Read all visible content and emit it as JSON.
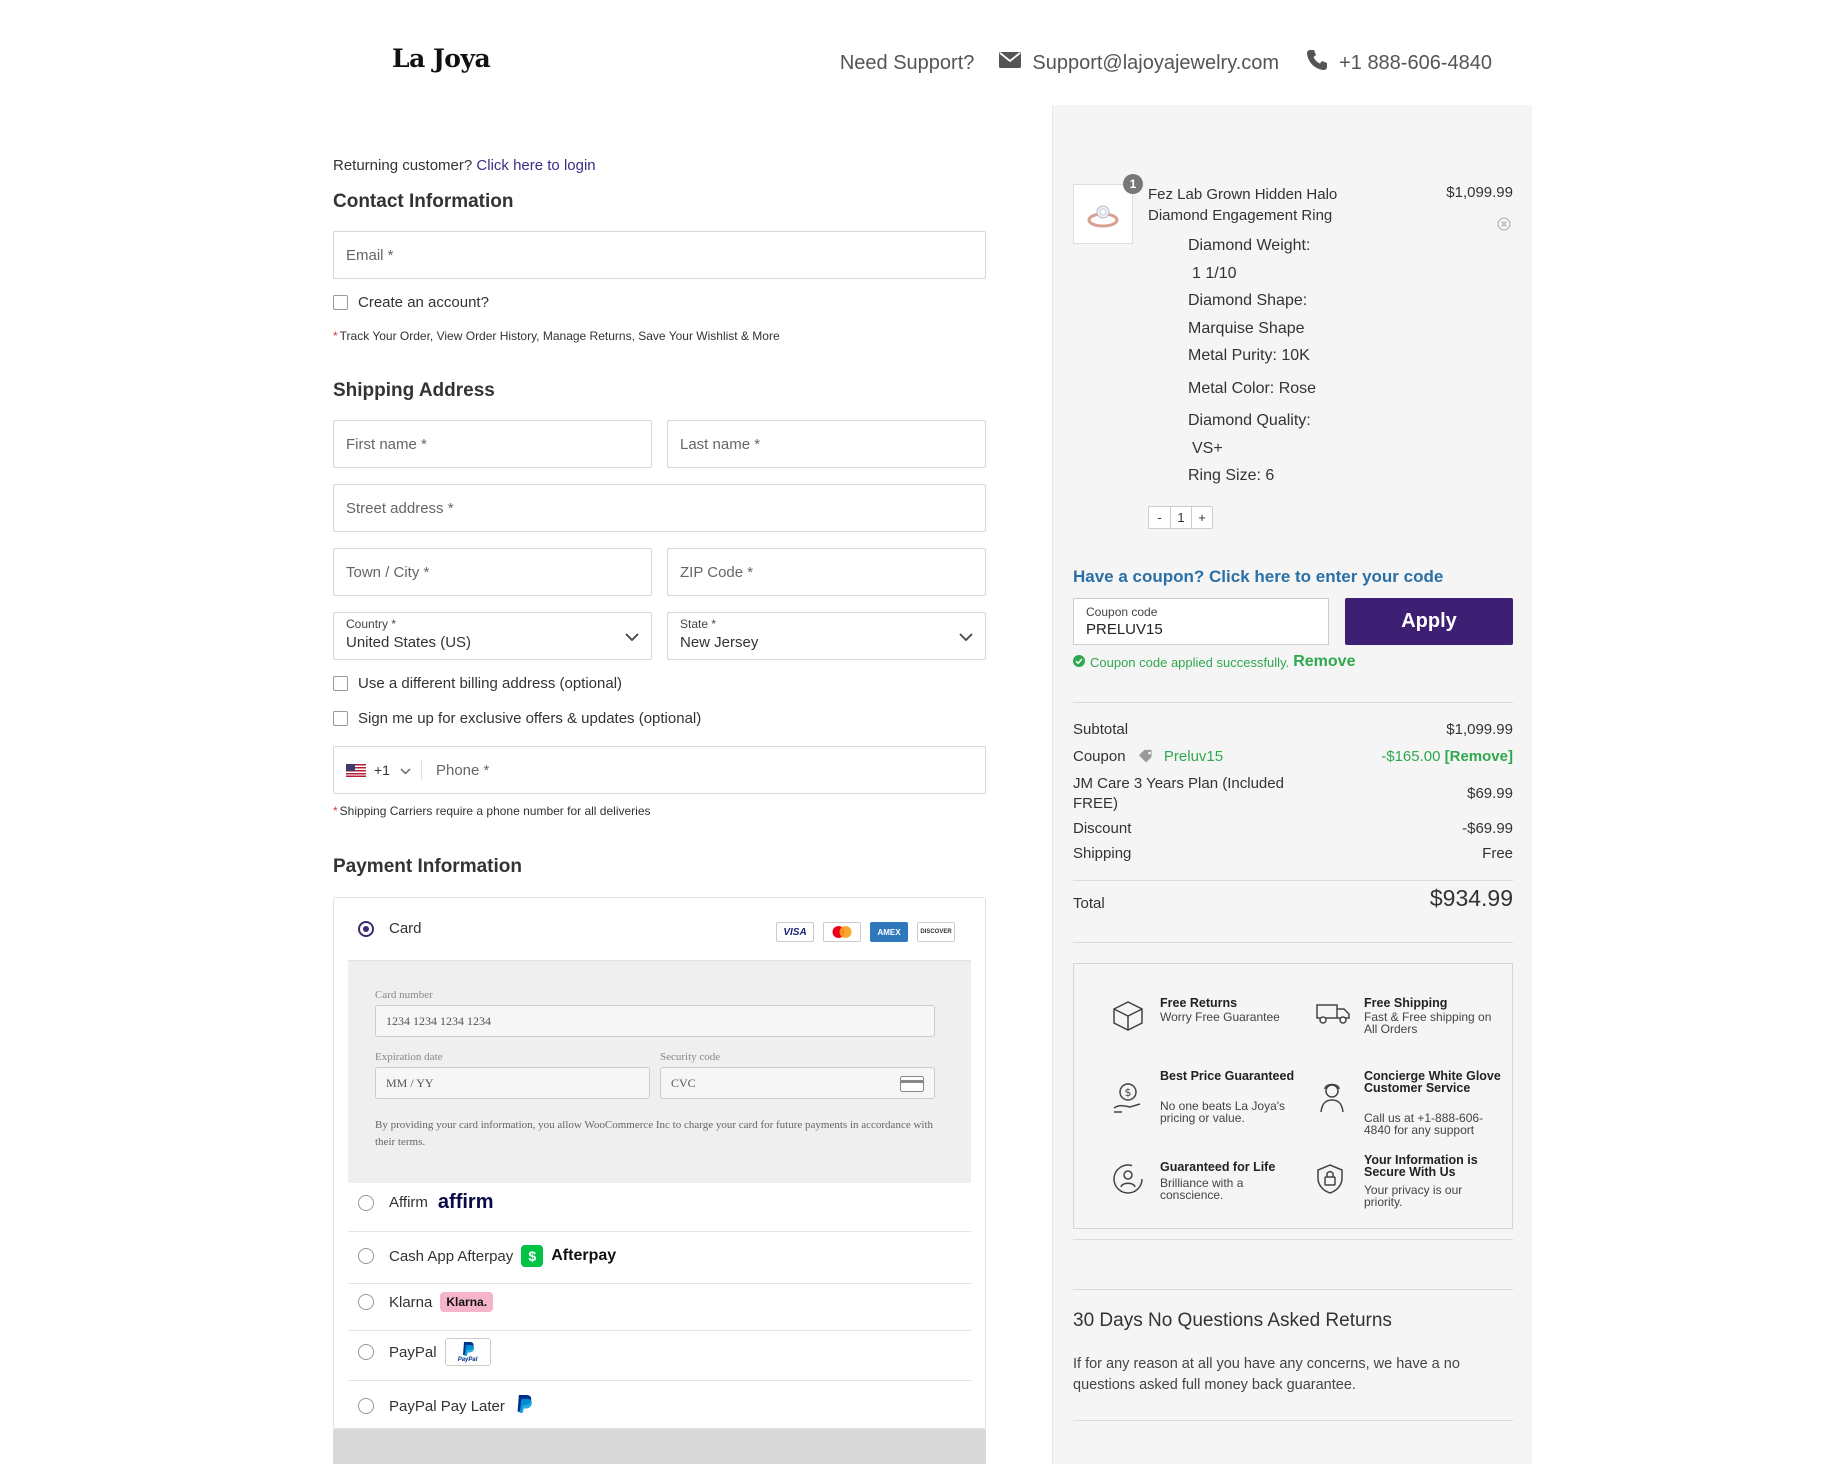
{
  "header": {
    "logo": "La Joya",
    "support_label": "Need Support?",
    "email": "Support@lajoyajewelry.com",
    "phone": "+1 888-606-4840"
  },
  "checkout": {
    "returning_text": "Returning customer?",
    "login_link": "Click here to login",
    "contact_title": "Contact Information",
    "email_placeholder": "Email *",
    "create_account": "Create an account?",
    "account_note": "Track Your Order, View Order History, Manage Returns, Save Your Wishlist & More",
    "shipping_title": "Shipping Address",
    "first_name": "First name *",
    "last_name": "Last name *",
    "street": "Street address *",
    "town": "Town / City *",
    "zip": "ZIP Code *",
    "country_label": "Country *",
    "country_value": "United States (US)",
    "state_label": "State *",
    "state_value": "New Jersey",
    "billing_check": "Use a different billing address (optional)",
    "signup_check": "Sign me up for exclusive offers & updates (optional)",
    "phone_code": "+1",
    "phone_placeholder": "Phone *",
    "phone_note": "Shipping Carriers require a phone number for all deliveries",
    "payment_title": "Payment Information"
  },
  "payment": {
    "card_label": "Card",
    "card_number_label": "Card number",
    "card_number_placeholder": "1234 1234 1234 1234",
    "expiry_label": "Expiration date",
    "expiry_placeholder": "MM / YY",
    "cvc_label": "Security code",
    "cvc_placeholder": "CVC",
    "card_note": "By providing your card information, you allow WooCommerce Inc to charge your card for future payments in accordance with their terms.",
    "affirm_label": "Affirm",
    "affirm_logo": "affirm",
    "afterpay_label": "Cash App Afterpay",
    "afterpay_logo": "Afterpay",
    "klarna_label": "Klarna",
    "klarna_logo": "Klarna.",
    "paypal_label": "PayPal",
    "paypal_logo": "PayPal",
    "paylater_label": "PayPal Pay Later",
    "card_brands": [
      "VISA",
      "AMEX",
      "DISCOVER"
    ]
  },
  "cart": {
    "qty_badge": "1",
    "product_name": "Fez Lab Grown Hidden Halo Diamond Engagement Ring",
    "product_price": "$1,099.99",
    "attributes": [
      "Diamond Weight:",
      "1 1/10",
      "Diamond Shape:",
      "Marquise Shape",
      "Metal Purity: 10K",
      "Metal Color: Rose",
      "Diamond Quality:",
      "VS+",
      "Ring Size: 6"
    ],
    "stepper_minus": "-",
    "stepper_qty": "1",
    "stepper_plus": "+"
  },
  "coupon": {
    "link_text": "Have a coupon? Click here to enter your code",
    "label": "Coupon code",
    "value": "PRELUV15",
    "apply": "Apply",
    "success": "Coupon code applied successfully.",
    "remove": "Remove"
  },
  "summary": {
    "subtotal_label": "Subtotal",
    "subtotal_value": "$1,099.99",
    "coupon_label": "Coupon",
    "coupon_code": "Preluv15",
    "coupon_value": "-$165.00",
    "coupon_remove": "[Remove]",
    "care_label": "JM Care 3 Years Plan (Included FREE)",
    "care_value": "$69.99",
    "discount_label": "Discount",
    "discount_value": "-$69.99",
    "shipping_label": "Shipping",
    "shipping_value": "Free",
    "total_label": "Total",
    "total_value": "$934.99"
  },
  "perks": [
    {
      "title": "Free Returns",
      "desc": "Worry Free Guarantee",
      "icon": "box-icon"
    },
    {
      "title": "Free Shipping",
      "desc": "Fast & Free shipping on All Orders",
      "icon": "truck-icon"
    },
    {
      "title": "Best Price Guaranteed",
      "desc": "No one beats La Joya's pricing or value.",
      "icon": "price-hand-icon"
    },
    {
      "title": "Concierge White Glove Customer Service",
      "desc": "Call us at +1-888-606-4840 for any support",
      "icon": "concierge-icon"
    },
    {
      "title": "Guaranteed for Life",
      "desc": "Brilliance with a conscience.",
      "icon": "lifetime-icon"
    },
    {
      "title": "Your Information is Secure With Us",
      "desc": "Your privacy is our priority.",
      "icon": "shield-lock-icon"
    }
  ],
  "returns": {
    "title": "30 Days No Questions Asked Returns",
    "text": "If for any reason at all you have any concerns, we have a no questions asked full money back guarantee."
  },
  "colors": {
    "brand_purple": "#3d1f73",
    "link_blue": "#2a6fa5",
    "success_green": "#2fa84f"
  }
}
